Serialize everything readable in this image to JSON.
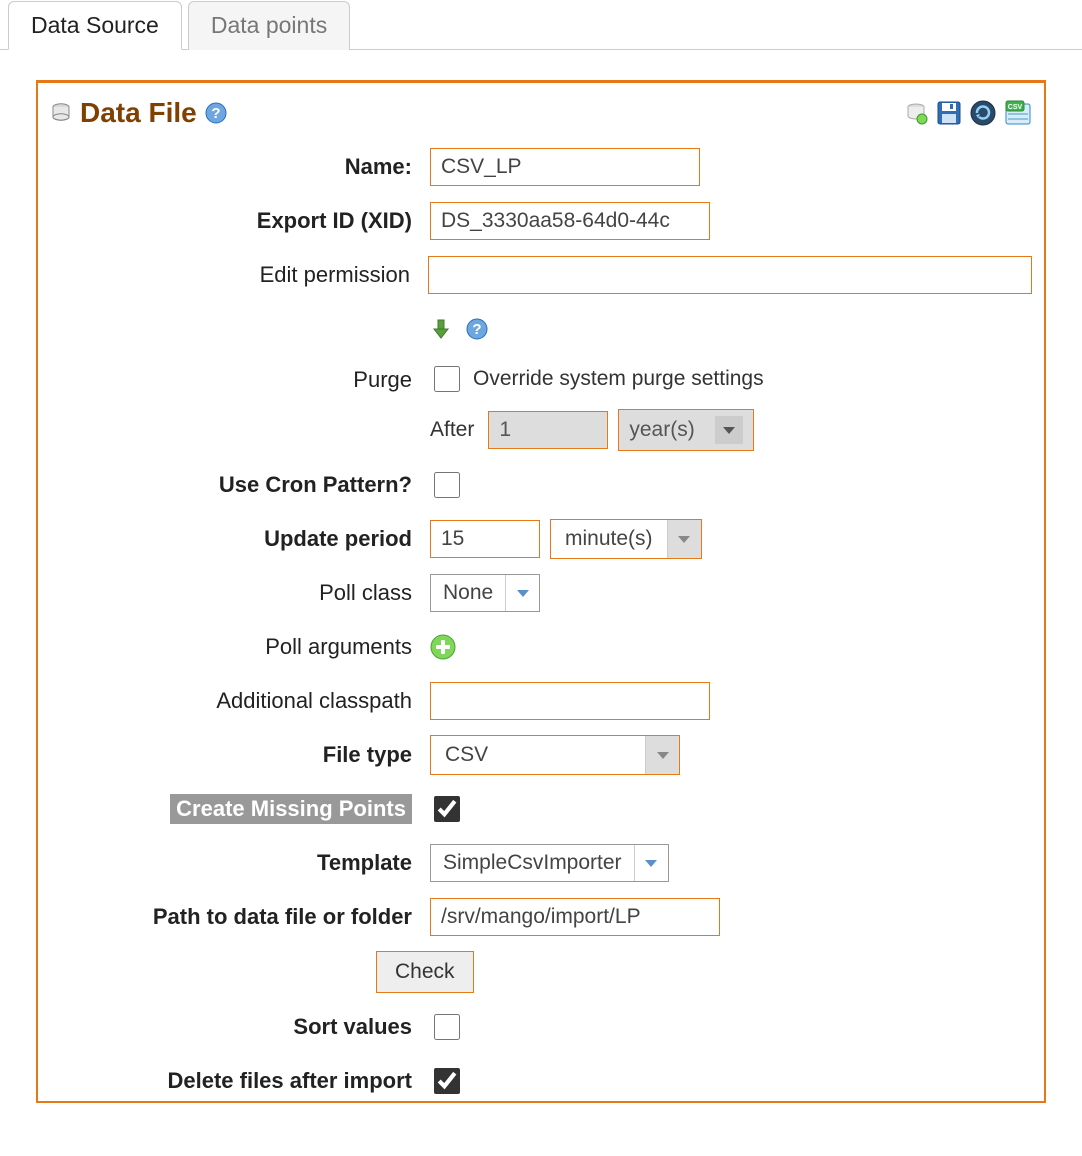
{
  "tabs": {
    "data_source": "Data Source",
    "data_points": "Data points"
  },
  "panel": {
    "title": "Data File"
  },
  "form": {
    "name_label": "Name:",
    "name_value": "CSV_LP",
    "xid_label": "Export ID (XID)",
    "xid_value": "DS_3330aa58-64d0-44c",
    "edit_perm_label": "Edit permission",
    "edit_perm_value": "",
    "purge_label": "Purge",
    "purge_override_label": "Override system purge settings",
    "purge_after_label": "After",
    "purge_after_value": "1",
    "purge_unit": "year(s)",
    "cron_label": "Use Cron Pattern?",
    "update_period_label": "Update period",
    "update_period_value": "15",
    "update_period_unit": "minute(s)",
    "poll_class_label": "Poll class",
    "poll_class_value": "None",
    "poll_args_label": "Poll arguments",
    "classpath_label": "Additional classpath",
    "classpath_value": "",
    "file_type_label": "File type",
    "file_type_value": "CSV",
    "create_missing_label": "Create Missing Points",
    "template_label": "Template",
    "template_value": "SimpleCsvImporter",
    "path_label": "Path to data file or folder",
    "path_value": "/srv/mango/import/LP",
    "check_button": "Check",
    "sort_values_label": "Sort values",
    "delete_files_label": "Delete files after import"
  }
}
